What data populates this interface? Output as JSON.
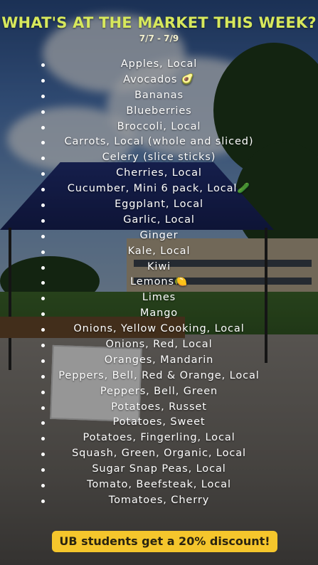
{
  "header": {
    "title": "WHAT'S AT THE MARKET THIS WEEK?",
    "dates": "7/7 - 7/9"
  },
  "items": [
    "Apples, Local",
    "Avocados 🥑",
    "Bananas",
    "Blueberries",
    "Broccoli, Local",
    "Carrots, Local (whole and sliced)",
    "Celery (slice sticks)",
    "Cherries, Local",
    "Cucumber, Mini 6 pack, Local🥒",
    "Eggplant, Local",
    "Garlic, Local",
    "Ginger",
    "Kale, Local",
    "Kiwi",
    "Lemons🍋",
    "Limes",
    "Mango",
    "Onions, Yellow Cooking, Local",
    "Onions, Red, Local",
    "Oranges, Mandarin",
    "Peppers, Bell, Red & Orange, Local",
    "Peppers, Bell, Green",
    "Potatoes, Russet",
    "Potatoes, Sweet",
    "Potatoes, Fingerling, Local",
    "Squash, Green, Organic, Local",
    "Sugar Snap Peas, Local",
    "Tomato, Beefsteak, Local",
    "Tomatoes, Cherry"
  ],
  "footer": {
    "discount": "UB students get a 20% discount!"
  },
  "colors": {
    "title": "#d7e85c",
    "badge": "#f5c62c",
    "text": "#ffffff"
  }
}
